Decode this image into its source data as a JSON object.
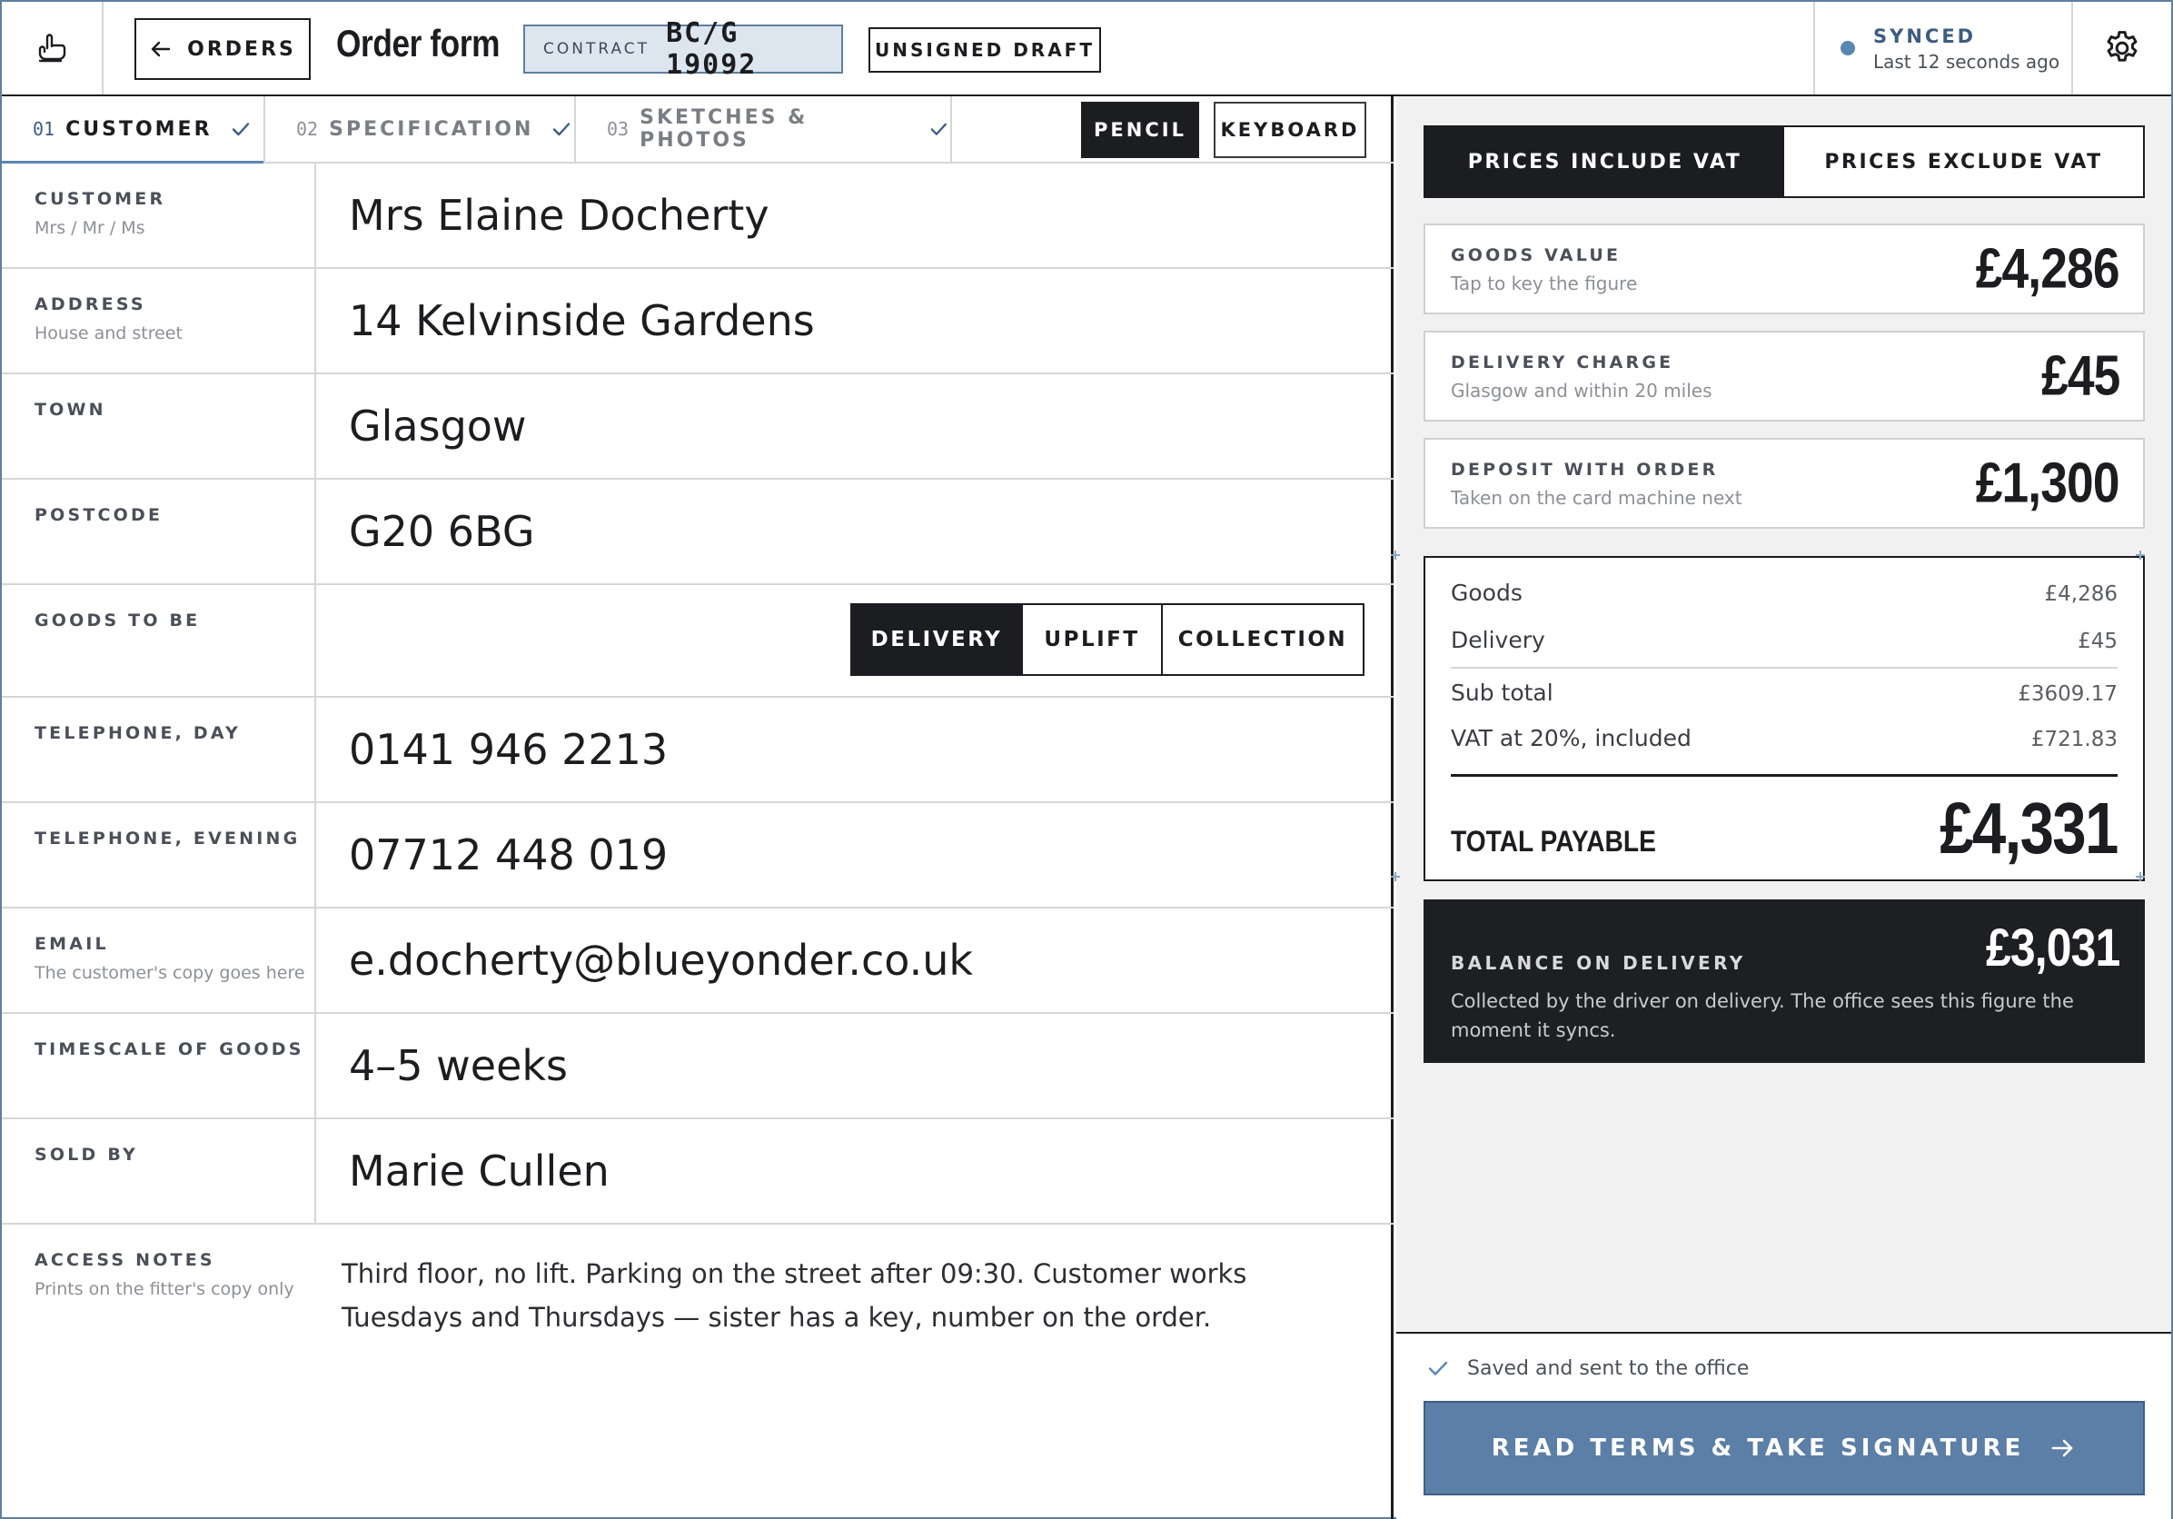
{
  "header": {
    "back_label": "ORDERS",
    "title": "Order form",
    "contract_label": "CONTRACT",
    "contract_number": "BC/G 19092",
    "status_badge": "UNSIGNED DRAFT",
    "sync_title": "SYNCED",
    "sync_sub": "Last 12 seconds ago",
    "accent_color": "#5a86b4"
  },
  "tabs": [
    {
      "num": "01",
      "label": "CUSTOMER",
      "done": true,
      "active": true
    },
    {
      "num": "02",
      "label": "SPECIFICATION",
      "done": true,
      "active": false
    },
    {
      "num": "03",
      "label": "SKETCHES & PHOTOS",
      "done": true,
      "active": false
    }
  ],
  "input_mode": {
    "pencil": "PENCIL",
    "keyboard": "KEYBOARD",
    "selected": "PENCIL"
  },
  "form": {
    "customer": {
      "label": "CUSTOMER",
      "hint": "Mrs / Mr / Ms",
      "value": "Mrs Elaine Docherty"
    },
    "address": {
      "label": "ADDRESS",
      "hint": "House and street",
      "value": "14 Kelvinside Gardens"
    },
    "town": {
      "label": "TOWN",
      "value": "Glasgow"
    },
    "postcode": {
      "label": "POSTCODE",
      "value": "G20 6BG"
    },
    "goods_to_be": {
      "label": "GOODS TO BE",
      "options": [
        "DELIVERY",
        "UPLIFT",
        "COLLECTION"
      ],
      "selected": "DELIVERY"
    },
    "tel_day": {
      "label": "TELEPHONE, DAY",
      "value": "0141 946 2213"
    },
    "tel_evening": {
      "label": "TELEPHONE, EVENING",
      "value": "07712 448 019"
    },
    "email": {
      "label": "EMAIL",
      "hint": "The customer's copy goes here",
      "value": "e.docherty@blueyonder.co.uk"
    },
    "timescale": {
      "label": "TIMESCALE OF GOODS",
      "value": "4–5 weeks"
    },
    "sold_by": {
      "label": "SOLD BY",
      "value": "Marie Cullen"
    },
    "access_notes": {
      "label": "ACCESS NOTES",
      "hint": "Prints on the fitter's copy only",
      "value": "Third floor, no lift. Parking on the street after 09:30. Customer works Tuesdays and Thursdays — sister has a key, number on the order."
    }
  },
  "pricing": {
    "vat_include": "PRICES INCLUDE VAT",
    "vat_exclude": "PRICES EXCLUDE VAT",
    "vat_selected": "PRICES INCLUDE VAT",
    "goods_value": {
      "label": "GOODS VALUE",
      "hint": "Tap to key the figure",
      "amount": "£4,286"
    },
    "delivery_charge": {
      "label": "DELIVERY CHARGE",
      "hint": "Glasgow and within 20 miles",
      "amount": "£45"
    },
    "deposit": {
      "label": "DEPOSIT WITH ORDER",
      "hint": "Taken on the card machine next",
      "amount": "£1,300"
    },
    "summary": {
      "goods_label": "Goods",
      "goods_value": "£4,286",
      "delivery_label": "Delivery",
      "delivery_value": "£45",
      "subtotal_label": "Sub total",
      "subtotal_value": "£3609.17",
      "vat_label": "VAT at 20%, included",
      "vat_value": "£721.83",
      "total_label": "TOTAL PAYABLE",
      "total_value": "£4,331"
    },
    "balance": {
      "label": "BALANCE ON DELIVERY",
      "amount": "£3,031",
      "note": "Collected by the driver on delivery. The office sees this figure the moment it syncs."
    }
  },
  "footer": {
    "saved_text": "Saved and sent to the office",
    "sign_label": "READ TERMS & TAKE SIGNATURE",
    "button_color": "#5b7fa6"
  }
}
